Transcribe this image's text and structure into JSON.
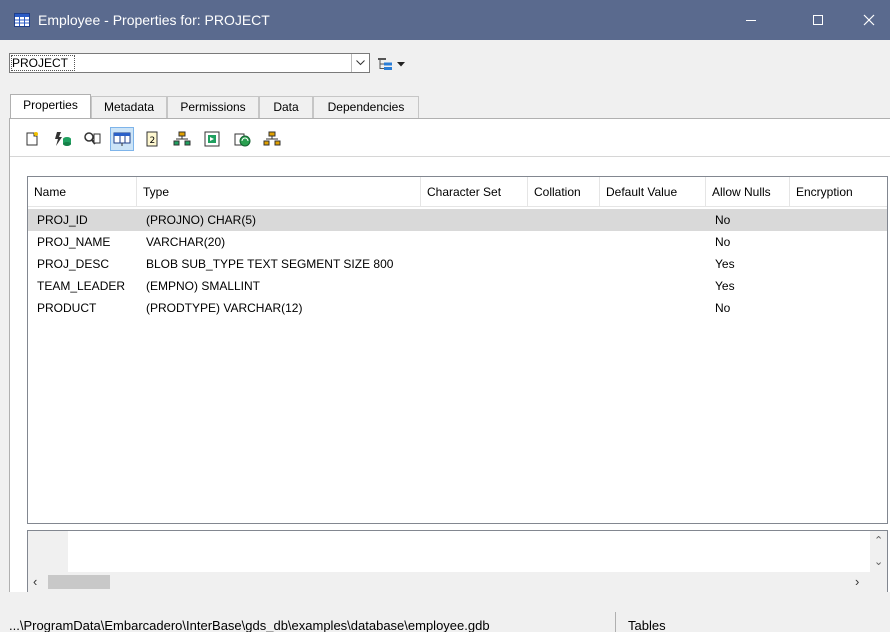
{
  "window": {
    "title": "Employee - Properties for: PROJECT",
    "icon": "table-grid-icon",
    "controls": [
      "minimize-icon",
      "maximize-icon",
      "close-icon"
    ]
  },
  "object_selector": {
    "value": "PROJECT",
    "tree_icon": "tree-view-icon"
  },
  "tabs": [
    {
      "label": "Properties",
      "active": true
    },
    {
      "label": "Metadata",
      "active": false
    },
    {
      "label": "Permissions",
      "active": false
    },
    {
      "label": "Data",
      "active": false
    },
    {
      "label": "Dependencies",
      "active": false
    }
  ],
  "toolbar": {
    "buttons": [
      "new-page-icon",
      "lightning-database-icon",
      "find-column-icon",
      "column-view-icon",
      "document-info-icon",
      "hierarchy-add-icon",
      "export-icon",
      "refresh-globe-icon",
      "hierarchy-icon"
    ],
    "pressed": "column-view-icon"
  },
  "grid": {
    "columns": [
      "Name",
      "Type",
      "Character Set",
      "Collation",
      "Default Value",
      "Allow Nulls",
      "Encryption"
    ],
    "rows": [
      {
        "name": "PROJ_ID",
        "type": "(PROJNO) CHAR(5)",
        "character_set": "",
        "collation": "",
        "default_value": "",
        "allow_nulls": "No",
        "encryption": ""
      },
      {
        "name": "PROJ_NAME",
        "type": "VARCHAR(20)",
        "character_set": "",
        "collation": "",
        "default_value": "",
        "allow_nulls": "No",
        "encryption": ""
      },
      {
        "name": "PROJ_DESC",
        "type": "BLOB SUB_TYPE TEXT SEGMENT SIZE 800",
        "character_set": "",
        "collation": "",
        "default_value": "",
        "allow_nulls": "Yes",
        "encryption": ""
      },
      {
        "name": "TEAM_LEADER",
        "type": "(EMPNO) SMALLINT",
        "character_set": "",
        "collation": "",
        "default_value": "",
        "allow_nulls": "Yes",
        "encryption": ""
      },
      {
        "name": "PRODUCT",
        "type": "(PRODTYPE) VARCHAR(12)",
        "character_set": "",
        "collation": "",
        "default_value": "",
        "allow_nulls": "No",
        "encryption": ""
      }
    ],
    "selected_row": 0
  },
  "status": {
    "path": "...\\ProgramData\\Embarcadero\\InterBase\\gds_db\\examples\\database\\employee.gdb",
    "section": "Tables"
  },
  "colors": {
    "titlebar": "#5a6a8e",
    "selected_row": "#d9d9d9",
    "pressed_button": "#cce4f7"
  }
}
